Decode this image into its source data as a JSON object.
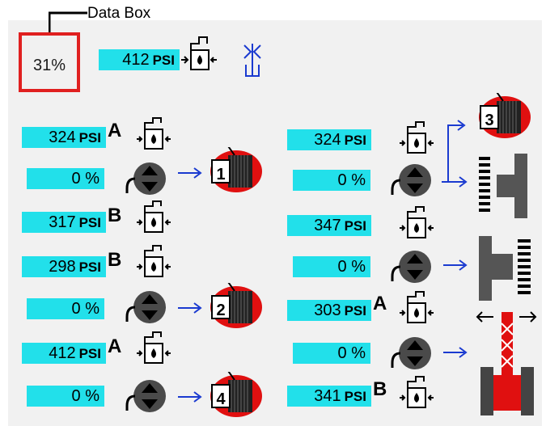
{
  "callout": {
    "label": "Data Box"
  },
  "data_box": {
    "value": "31%"
  },
  "top": {
    "pressure": "412",
    "unit": "PSI"
  },
  "left_rows": [
    {
      "value": "324",
      "unit": "PSI",
      "letter": "A"
    },
    {
      "value": "0 %",
      "unit": "",
      "letter": ""
    },
    {
      "value": "317",
      "unit": "PSI",
      "letter": "B"
    },
    {
      "value": "298",
      "unit": "PSI",
      "letter": "B"
    },
    {
      "value": "0 %",
      "unit": "",
      "letter": ""
    },
    {
      "value": "412",
      "unit": "PSI",
      "letter": "A"
    },
    {
      "value": "0 %",
      "unit": "",
      "letter": ""
    }
  ],
  "right_rows": [
    {
      "value": "324",
      "unit": "PSI",
      "letter": ""
    },
    {
      "value": "0 %",
      "unit": "",
      "letter": ""
    },
    {
      "value": "347",
      "unit": "PSI",
      "letter": ""
    },
    {
      "value": "0 %",
      "unit": "",
      "letter": ""
    },
    {
      "value": "303",
      "unit": "PSI",
      "letter": "A"
    },
    {
      "value": "0 %",
      "unit": "",
      "letter": ""
    },
    {
      "value": "341",
      "unit": "PSI",
      "letter": "B"
    }
  ],
  "drums": {
    "d1": "1",
    "d2": "2",
    "d3": "3",
    "d4": "4"
  },
  "icons": [
    "valve-icon",
    "pump-motor-icon",
    "winch-drum-icon",
    "track-icon",
    "crane-icon",
    "spring-icon"
  ],
  "colors": {
    "value_bg": "#22e0ea",
    "accent": "#e02020",
    "arrow": "#1a3ad0"
  }
}
